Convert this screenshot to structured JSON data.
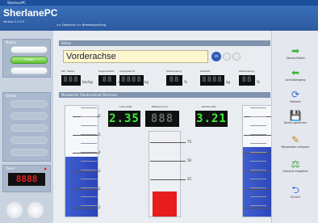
{
  "window_title": "SherlanePC",
  "app": {
    "name": "SherlanePC",
    "version": "Version 2.0.0.3"
  },
  "breadcrumb": [
    ">>",
    "Übersicht",
    ">>",
    "Bremsenprüfung"
  ],
  "left": {
    "modes_label": "Modus",
    "mode_buttons": [
      "",
      "Prüfen",
      ""
    ],
    "devices_label": "Geräte",
    "device_buttons": [
      "",
      "",
      "",
      "",
      ""
    ],
    "timer_label": "Timer",
    "timer_value": "8888",
    "timer_status": "●"
  },
  "axle": {
    "section_label": "Achse",
    "name": "Vorderachse",
    "badge": "VA"
  },
  "fields": {
    "pw_label": "PW / Pedal",
    "pw_value": "888",
    "pw_unit": "bar/kg",
    "time_label": "Ansprechzeit",
    "time_value": "88",
    "time_unit": "s",
    "load_label": "Achsgewicht",
    "load_value": "8888",
    "load_unit": "kg",
    "load_pct_value": "88",
    "load_pct_unit": "%",
    "weight_label": "Gewicht",
    "weight_value": "8888",
    "weight_unit": "kg",
    "dev_label": "Abbremsung",
    "dev_value": "88",
    "dev_unit": "%"
  },
  "measure": {
    "section_label": "Messwerte (Vorderachse) Bremsen",
    "left_label": "Links [kN]",
    "left_value": "2.35",
    "diff_label": "Differenz [%]",
    "diff_value": "888",
    "right_label": "Rechts [kN]",
    "right_value": "3.21",
    "diff_scale": [
      "75",
      "50",
      "25"
    ],
    "force_scale": [
      "6",
      "5",
      "4",
      "3",
      "2",
      "1"
    ],
    "left_fill_kn": 2.35,
    "right_fill_kn": 3.21,
    "diff_fill_pct": 24
  },
  "right": [
    {
      "label": "Stereo-Detail",
      "icon": "arrow-right-icon",
      "color": "#3db43a"
    },
    {
      "label": "Achsübergang",
      "icon": "arrow-left-icon",
      "color": "#3db43a"
    },
    {
      "label": "Refresh",
      "icon": "refresh-icon",
      "color": "#2a6bd1"
    },
    {
      "label": "Daten speichern",
      "icon": "save-icon",
      "color": "#555"
    },
    {
      "label": "Messdaten erfassen",
      "icon": "edit-icon",
      "color": "#c58a1c"
    },
    {
      "label": "Gewicht eingeben",
      "icon": "weight-icon",
      "color": "#3a9a3a"
    },
    {
      "label": "Zurück",
      "icon": "back-icon",
      "color": "#2a6bd1"
    }
  ]
}
